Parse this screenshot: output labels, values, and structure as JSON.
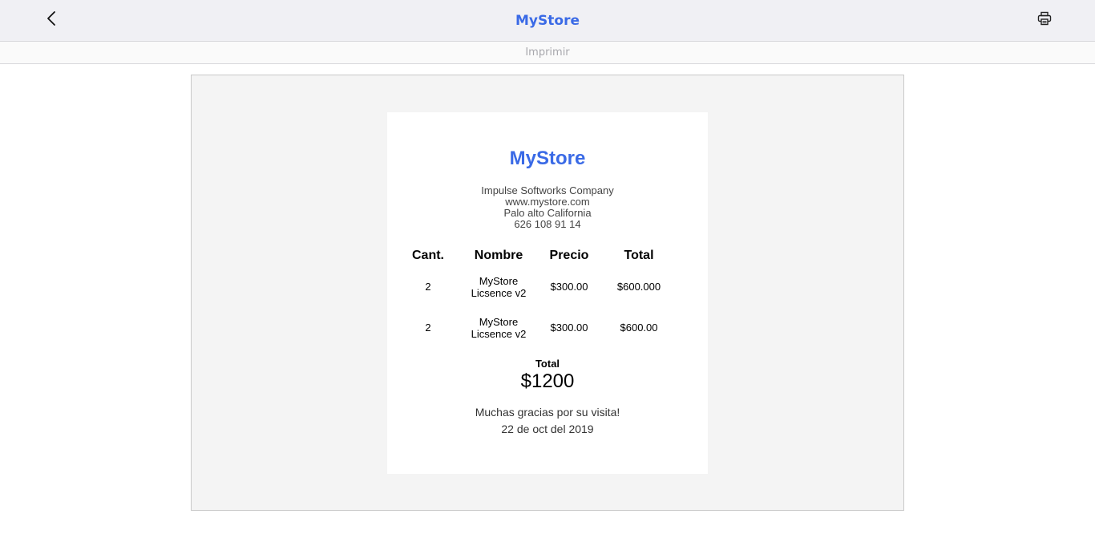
{
  "toolbar": {
    "title": "MyStore",
    "back_icon": "chevron-left-icon",
    "print_icon": "printer-icon"
  },
  "subbar": {
    "label": "Imprimir"
  },
  "receipt": {
    "store_name": "MyStore",
    "info": [
      "Impulse Softworks Company",
      "www.mystore.com",
      "Palo alto California",
      "626 108 91 14"
    ],
    "columns": [
      "Cant.",
      "Nombre",
      "Precio",
      "Total"
    ],
    "rows": [
      {
        "qty": "2",
        "name": "MyStore Licsence v2",
        "price": "$300.00",
        "total": "$600.000"
      },
      {
        "qty": "2",
        "name": "MyStore Licsence v2",
        "price": "$300.00",
        "total": "$600.00"
      }
    ],
    "total_label": "Total",
    "total_value": "$1200",
    "thanks": "Muchas gracias por su visita!",
    "date": "22 de oct del 2019"
  },
  "colors": {
    "accent": "#3a6ae6",
    "toolbar_bg": "#f0f0f4",
    "preview_bg": "#f4f4f4"
  }
}
